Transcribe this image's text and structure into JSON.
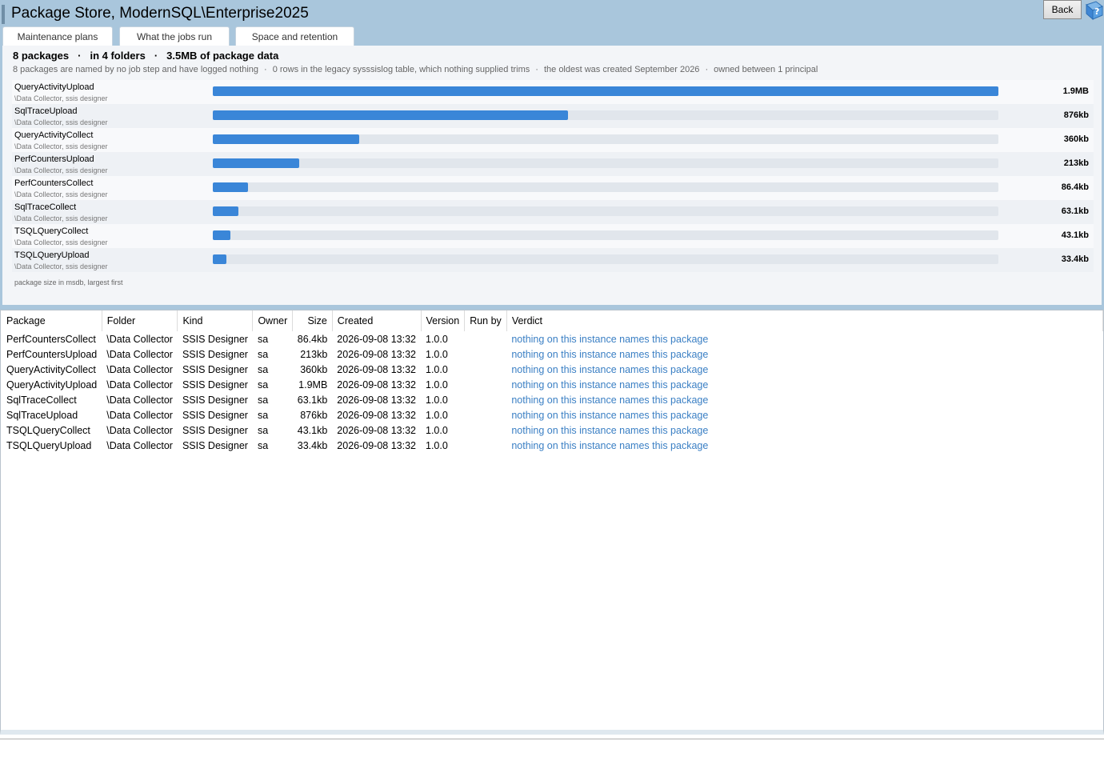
{
  "window": {
    "title": "Package Store, ModernSQL\\Enterprise2025",
    "back_label": "Back",
    "help_icon": "help-book-icon"
  },
  "tabs": [
    {
      "label": "Maintenance plans"
    },
    {
      "label": "What the jobs run"
    },
    {
      "label": "Space and retention"
    }
  ],
  "summary": {
    "count": "8 packages",
    "folders": "in 4 folders",
    "data": "3.5MB of package data",
    "sep": "·",
    "sub1": "8 packages are named by no job step and have logged nothing",
    "sub2": "0 rows in the legacy sysssislog table, which nothing supplied trims",
    "sub3": "the oldest was created September 2026",
    "sub4": "owned between 1 principal",
    "dot": "·"
  },
  "size_chart": {
    "caption": "package size in msdb, largest first",
    "bars": [
      {
        "name": "QueryActivityUpload",
        "folder": "\\Data Collector, ssis designer",
        "size": "1.9MB",
        "fraction": 1.0
      },
      {
        "name": "SqlTraceUpload",
        "folder": "\\Data Collector, ssis designer",
        "size": "876kb",
        "fraction": 0.4525
      },
      {
        "name": "QueryActivityCollect",
        "folder": "\\Data Collector, ssis designer",
        "size": "360kb",
        "fraction": 0.186
      },
      {
        "name": "PerfCountersUpload",
        "folder": "\\Data Collector, ssis designer",
        "size": "213kb",
        "fraction": 0.11
      },
      {
        "name": "PerfCountersCollect",
        "folder": "\\Data Collector, ssis designer",
        "size": "86.4kb",
        "fraction": 0.0446
      },
      {
        "name": "SqlTraceCollect",
        "folder": "\\Data Collector, ssis designer",
        "size": "63.1kb",
        "fraction": 0.0326
      },
      {
        "name": "TSQLQueryCollect",
        "folder": "\\Data Collector, ssis designer",
        "size": "43.1kb",
        "fraction": 0.0223
      },
      {
        "name": "TSQLQueryUpload",
        "folder": "\\Data Collector, ssis designer",
        "size": "33.4kb",
        "fraction": 0.0173
      }
    ]
  },
  "table": {
    "headers": [
      "Package",
      "Folder",
      "Kind",
      "Owner",
      "Size",
      "Created",
      "Version",
      "Run by",
      "Verdict"
    ],
    "rows": [
      [
        "PerfCountersCollect",
        "\\Data Collector",
        "SSIS Designer",
        "sa",
        "86.4kb",
        "2026-09-08 13:32",
        "1.0.0",
        "",
        "nothing on this instance names this package"
      ],
      [
        "PerfCountersUpload",
        "\\Data Collector",
        "SSIS Designer",
        "sa",
        "213kb",
        "2026-09-08 13:32",
        "1.0.0",
        "",
        "nothing on this instance names this package"
      ],
      [
        "QueryActivityCollect",
        "\\Data Collector",
        "SSIS Designer",
        "sa",
        "360kb",
        "2026-09-08 13:32",
        "1.0.0",
        "",
        "nothing on this instance names this package"
      ],
      [
        "QueryActivityUpload",
        "\\Data Collector",
        "SSIS Designer",
        "sa",
        "1.9MB",
        "2026-09-08 13:32",
        "1.0.0",
        "",
        "nothing on this instance names this package"
      ],
      [
        "SqlTraceCollect",
        "\\Data Collector",
        "SSIS Designer",
        "sa",
        "63.1kb",
        "2026-09-08 13:32",
        "1.0.0",
        "",
        "nothing on this instance names this package"
      ],
      [
        "SqlTraceUpload",
        "\\Data Collector",
        "SSIS Designer",
        "sa",
        "876kb",
        "2026-09-08 13:32",
        "1.0.0",
        "",
        "nothing on this instance names this package"
      ],
      [
        "TSQLQueryCollect",
        "\\Data Collector",
        "SSIS Designer",
        "sa",
        "43.1kb",
        "2026-09-08 13:32",
        "1.0.0",
        "",
        "nothing on this instance names this package"
      ],
      [
        "TSQLQueryUpload",
        "\\Data Collector",
        "SSIS Designer",
        "sa",
        "33.4kb",
        "2026-09-08 13:32",
        "1.0.0",
        "",
        "nothing on this instance names this package"
      ]
    ]
  },
  "colors": {
    "header_bg": "#a9c6dc",
    "bar_fill": "#3a86d8",
    "bar_track": "#e1e6ec",
    "verdict_text": "#3a7fc4"
  }
}
